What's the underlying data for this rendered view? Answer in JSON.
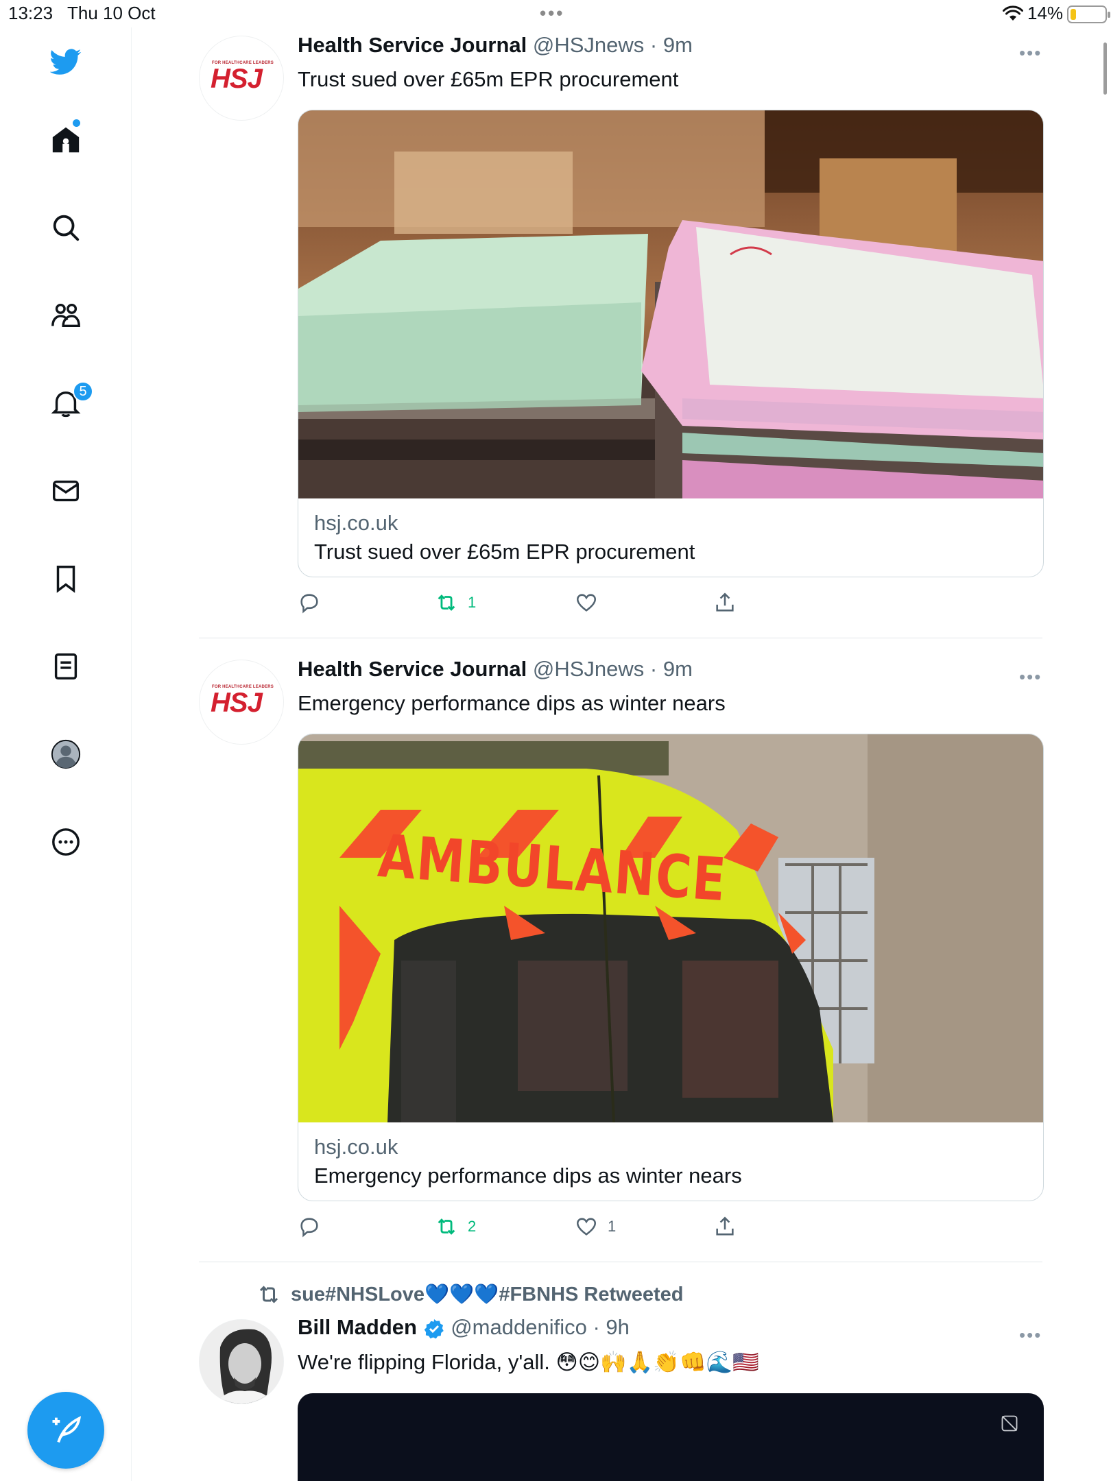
{
  "status_bar": {
    "time": "13:23",
    "date": "Thu 10 Oct",
    "battery_percent": "14%",
    "battery_level": 0.14
  },
  "sidebar": {
    "items": [
      {
        "name": "twitter-logo-icon"
      },
      {
        "name": "home-icon"
      },
      {
        "name": "search-icon"
      },
      {
        "name": "communities-icon"
      },
      {
        "name": "notifications-icon"
      },
      {
        "name": "messages-icon"
      },
      {
        "name": "bookmarks-icon"
      },
      {
        "name": "lists-icon"
      },
      {
        "name": "profile-icon"
      },
      {
        "name": "more-icon"
      }
    ],
    "notification_count": "5",
    "accent": "#1d9bf0"
  },
  "tweets": [
    {
      "avatar_logo": "HSJ",
      "avatar_tagline": "FOR HEALTHCARE LEADERS",
      "name": "Health Service Journal",
      "handle": "@HSJnews",
      "time": "· 9m",
      "text": "Trust sued over £65m EPR procurement",
      "card": {
        "domain": "hsj.co.uk",
        "title": "Trust sued over £65m EPR procurement"
      },
      "actions": {
        "reply": "",
        "retweet": "1",
        "like": "",
        "share": ""
      }
    },
    {
      "avatar_logo": "HSJ",
      "avatar_tagline": "FOR HEALTHCARE LEADERS",
      "name": "Health Service Journal",
      "handle": "@HSJnews",
      "time": "· 9m",
      "text": "Emergency performance dips as winter nears",
      "card": {
        "domain": "hsj.co.uk",
        "title": "Emergency performance dips as winter nears",
        "image_text": "AMBULANCE"
      },
      "actions": {
        "reply": "",
        "retweet": "2",
        "like": "1",
        "share": ""
      }
    },
    {
      "retweeted_by_prefix": "sue#NHSLove",
      "retweeted_by_hearts": "💙💙💙",
      "retweeted_by_suffix": "#FBNHS Retweeted",
      "name": "Bill Madden",
      "handle": "@maddenifico",
      "time": "· 9h",
      "text": "We're flipping Florida, y'all. 😳😊🙌🙏👏👊🌊🇺🇸"
    }
  ]
}
